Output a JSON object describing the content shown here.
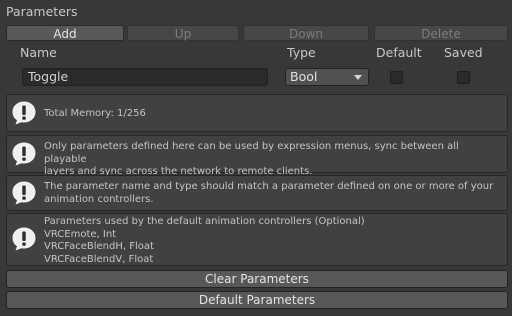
{
  "section_title": "Parameters",
  "toolbar": {
    "add_label": "Add",
    "up_label": "Up",
    "down_label": "Down",
    "delete_label": "Delete"
  },
  "columns": {
    "name": "Name",
    "type": "Type",
    "default": "Default",
    "saved": "Saved"
  },
  "parameter_row": {
    "name_value": "Toggle",
    "type_value": "Bool",
    "default_checked": false,
    "saved_checked": false
  },
  "help_boxes": [
    {
      "icon": "info-icon",
      "lines": [
        "Total Memory: 1/256"
      ]
    },
    {
      "icon": "info-icon",
      "lines": [
        "Only parameters defined here can be used by expression menus, sync between all playable",
        "layers and sync across the network to remote clients."
      ]
    },
    {
      "icon": "info-icon",
      "lines": [
        "The parameter name and type should match a parameter defined on one or more of your",
        "animation controllers."
      ]
    },
    {
      "icon": "info-icon",
      "lines": [
        "Parameters used by the default animation controllers (Optional)",
        "VRCEmote, Int",
        "VRCFaceBlendH, Float",
        "VRCFaceBlendV, Float"
      ]
    }
  ],
  "buttons": {
    "clear_label": "Clear Parameters",
    "default_label": "Default Parameters"
  },
  "colors": {
    "background": "#383838",
    "icon_fill": "#f0f0f0",
    "icon_glyph": "#2b2b2b"
  }
}
